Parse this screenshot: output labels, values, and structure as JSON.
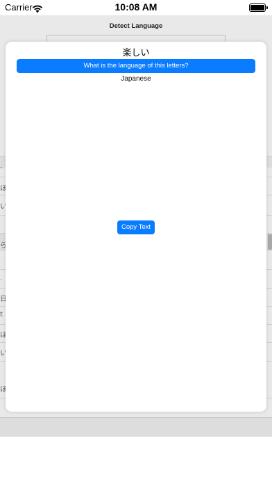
{
  "status_bar": {
    "carrier": "Carrier",
    "time": "10:08 AM",
    "wifi_icon": "wifi-icon",
    "battery_icon": "battery-icon"
  },
  "background_screen": {
    "title": "Detect Language",
    "fragments": [
      "-",
      "ほし",
      "いら",
      "らし",
      ".",
      "日本",
      "t",
      "ほし",
      "いて",
      "ほし"
    ]
  },
  "sheet": {
    "word": "楽しい",
    "question_button": "What is the language of this letters?",
    "result": "Japanese",
    "copy_button": "Copy Text"
  },
  "colors": {
    "accent": "#0a7cff",
    "dim_background": "#e9e9e9"
  }
}
